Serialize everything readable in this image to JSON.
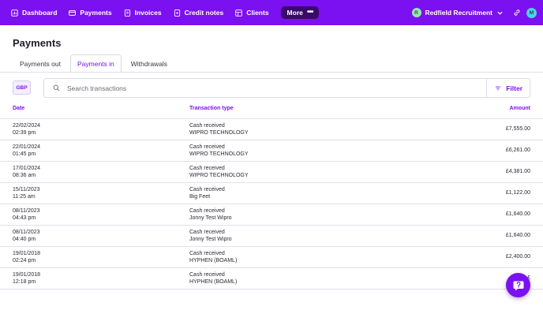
{
  "nav": {
    "items": [
      {
        "label": "Dashboard",
        "icon": "dashboard-icon"
      },
      {
        "label": "Payments",
        "icon": "payments-icon"
      },
      {
        "label": "Invoices",
        "icon": "invoices-icon"
      },
      {
        "label": "Credit notes",
        "icon": "credit-notes-icon"
      },
      {
        "label": "Clients",
        "icon": "clients-icon"
      }
    ],
    "more_label": "More",
    "more_icon": "•••",
    "org_initial": "R",
    "org_name": "Redfield Recruitment",
    "user_initial": "M"
  },
  "page": {
    "title": "Payments"
  },
  "tabs": [
    {
      "label": "Payments out",
      "active": false
    },
    {
      "label": "Payments in",
      "active": true
    },
    {
      "label": "Withdrawals",
      "active": false
    }
  ],
  "toolbar": {
    "currency": "GBP",
    "search_placeholder": "Search transactions",
    "search_value": "",
    "filter_label": "Filter"
  },
  "table": {
    "columns": {
      "date": "Date",
      "type": "Transaction type",
      "amount": "Amount"
    },
    "rows": [
      {
        "date": "22/02/2024",
        "time": "02:39 pm",
        "type": "Cash received",
        "party": "WIPRO TECHNOLOGY",
        "amount": "£7,555.00"
      },
      {
        "date": "22/01/2024",
        "time": "01:45 pm",
        "type": "Cash received",
        "party": "WIPRO TECHNOLOGY",
        "amount": "£6,261.00"
      },
      {
        "date": "17/01/2024",
        "time": "08:36 am",
        "type": "Cash received",
        "party": "WIPRO TECHNOLOGY",
        "amount": "£4,381.00"
      },
      {
        "date": "15/11/2023",
        "time": "11:25 am",
        "type": "Cash received",
        "party": "Big Feet",
        "amount": "£1,122.00"
      },
      {
        "date": "08/11/2023",
        "time": "04:43 pm",
        "type": "Cash received",
        "party": "Jonny Test Wipro",
        "amount": "£1,640.00"
      },
      {
        "date": "08/11/2023",
        "time": "04:40 pm",
        "type": "Cash received",
        "party": "Jonny Test Wipro",
        "amount": "£1,640.00"
      },
      {
        "date": "19/01/2018",
        "time": "02:24 pm",
        "type": "Cash received",
        "party": "HYPHEN (BOAML)",
        "amount": "£2,400.00"
      },
      {
        "date": "19/01/2018",
        "time": "12:18 pm",
        "type": "Cash received",
        "party": "HYPHEN (BOAML)",
        "amount": "£"
      }
    ]
  },
  "colors": {
    "brand": "#7b10f0",
    "more_bg": "#3a0a6a",
    "org_avatar": "#9ae6b4",
    "user_avatar": "#4fd1e8"
  }
}
